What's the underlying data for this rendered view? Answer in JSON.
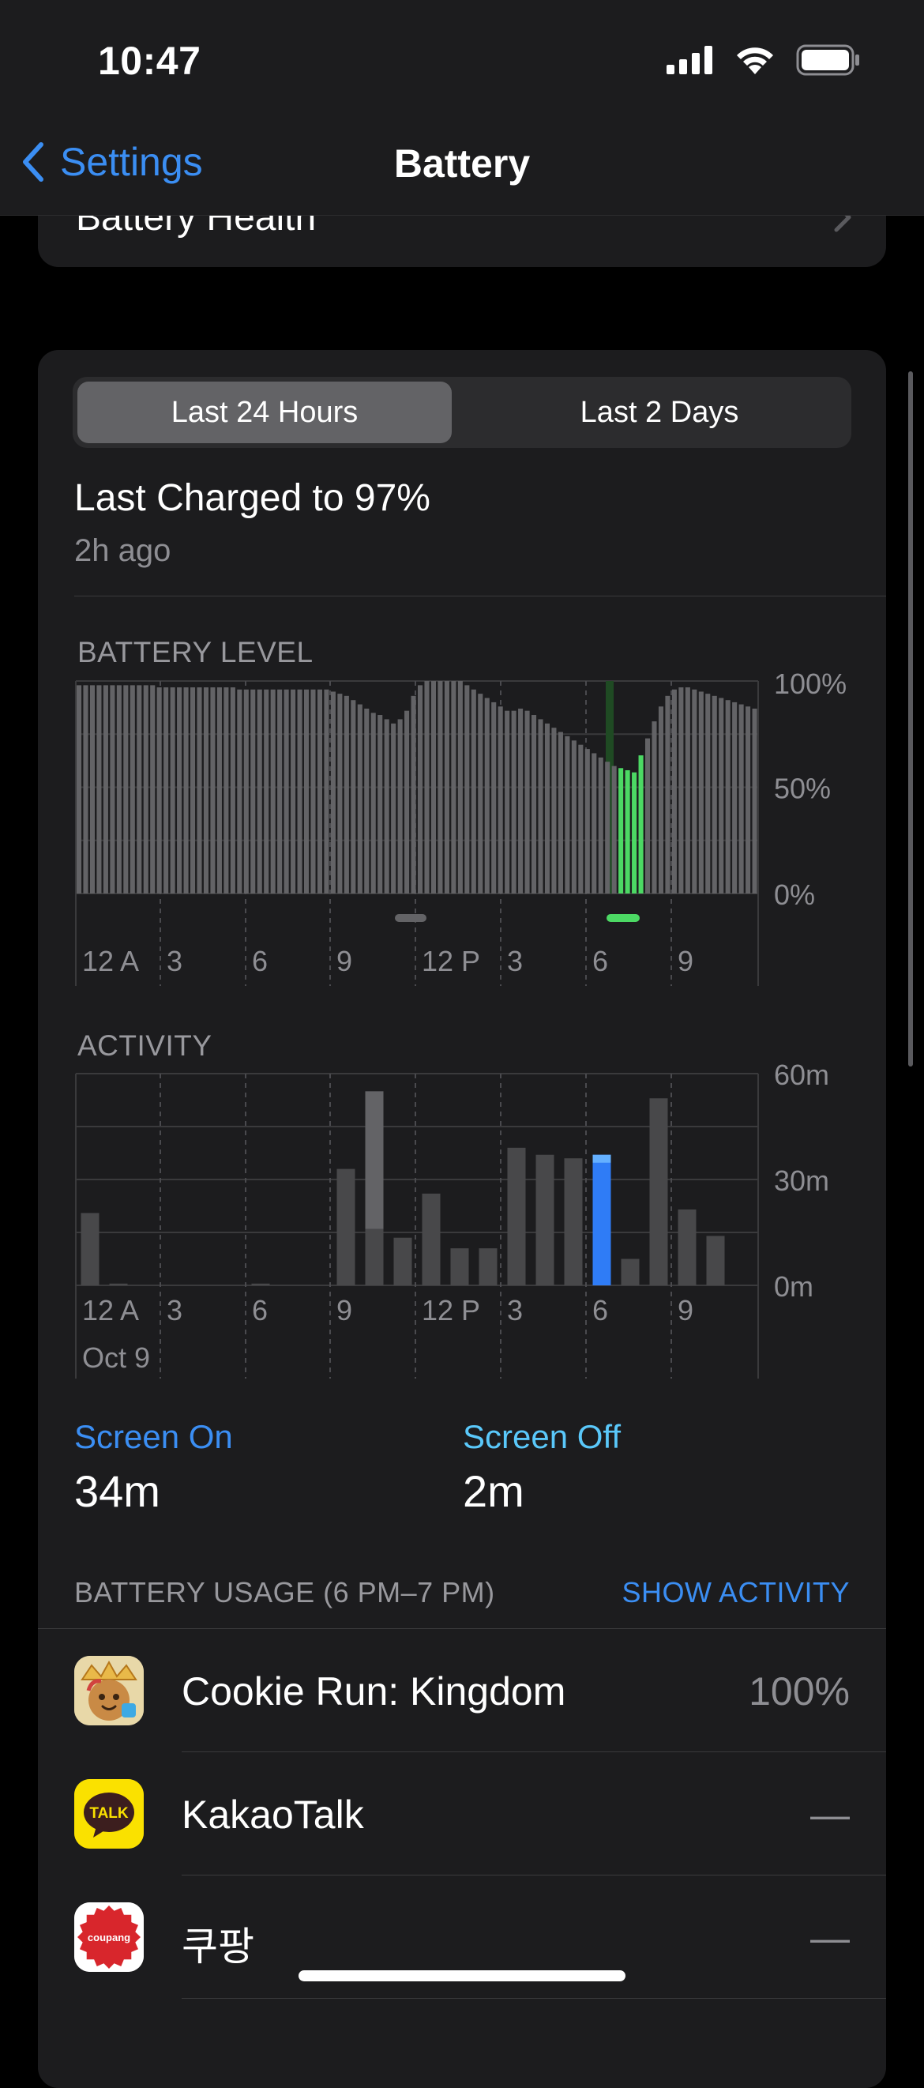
{
  "status": {
    "time": "10:47"
  },
  "nav": {
    "back_label": "Settings",
    "title": "Battery"
  },
  "health": {
    "label": "Battery Health"
  },
  "segment": {
    "options": [
      "Last 24 Hours",
      "Last 2 Days"
    ],
    "selected": "Last 24 Hours"
  },
  "last_charged": {
    "title": "Last Charged to 97%",
    "ago": "2h ago"
  },
  "battery_level": {
    "label": "BATTERY LEVEL",
    "y_ticks": [
      "100%",
      "50%",
      "0%"
    ],
    "x_ticks": [
      "12 A",
      "3",
      "6",
      "9",
      "12 P",
      "3",
      "6",
      "9"
    ]
  },
  "activity": {
    "label": "ACTIVITY",
    "y_ticks": [
      "60m",
      "30m",
      "0m"
    ],
    "x_ticks": [
      "12 A",
      "3",
      "6",
      "9",
      "12 P",
      "3",
      "6",
      "9"
    ],
    "date": "Oct 9"
  },
  "chart_data": [
    {
      "type": "bar",
      "title": "BATTERY LEVEL",
      "ylim": [
        0,
        100
      ],
      "x_unit": "hours since 12 AM",
      "values": [
        98,
        98,
        98,
        98,
        98,
        98,
        98,
        98,
        98,
        98,
        98,
        98,
        97,
        97,
        97,
        97,
        97,
        97,
        97,
        97,
        97,
        97,
        97,
        97,
        96,
        96,
        96,
        96,
        96,
        96,
        96,
        96,
        96,
        96,
        96,
        96,
        96,
        96,
        95,
        94,
        93,
        91,
        89,
        87,
        85,
        84,
        82,
        80,
        82,
        86,
        93,
        98,
        100,
        100,
        100,
        100,
        100,
        100,
        98,
        96,
        94,
        92,
        90,
        88,
        86,
        86,
        87,
        86,
        84,
        82,
        80,
        78,
        76,
        74,
        72,
        70,
        68,
        66,
        64,
        62,
        60,
        59,
        58,
        57,
        65,
        73,
        81,
        88,
        93,
        96,
        97,
        97,
        96,
        95,
        94,
        93,
        92,
        91,
        90,
        89,
        88,
        87
      ],
      "charging_indices": [
        81,
        82,
        83,
        84
      ],
      "charging_color": "#4cd964",
      "bar_color": "#636366",
      "grid": true
    },
    {
      "type": "bar",
      "title": "ACTIVITY",
      "ylim": [
        0,
        60
      ],
      "x_unit": "hours since 12 AM",
      "categories": [
        "12 A",
        "",
        "",
        "3",
        "",
        "",
        "6",
        "",
        "",
        "9",
        "",
        "",
        "12 P",
        "",
        "",
        "3",
        "",
        "",
        "6",
        "",
        "",
        "9",
        "",
        ""
      ],
      "series": [
        {
          "name": "Screen On",
          "values": [
            20.5,
            0.5,
            0,
            0,
            0,
            0,
            0.5,
            0,
            0,
            33,
            16,
            13.5,
            26,
            10.5,
            10.5,
            39,
            37,
            36,
            37,
            7.5,
            53,
            21.5,
            14,
            0
          ]
        },
        {
          "name": "Screen Off",
          "values": [
            0,
            0,
            0,
            0,
            0,
            0,
            0,
            0,
            0,
            0,
            39,
            0,
            0,
            0,
            0,
            0,
            0,
            0,
            0,
            0,
            0,
            0,
            0,
            0
          ]
        }
      ],
      "selected_hour": 18,
      "selected_color_on": "#2f7cf6",
      "selected_color_off": "#64b0ff",
      "grid": true
    }
  ],
  "screen_on": {
    "label": "Screen On",
    "value": "34m"
  },
  "screen_off": {
    "label": "Screen Off",
    "value": "2m"
  },
  "usage": {
    "header": "BATTERY USAGE (6 PM–7 PM)",
    "show_activity": "SHOW ACTIVITY",
    "apps": [
      {
        "name": "Cookie Run: Kingdom",
        "value": "100%"
      },
      {
        "name": "KakaoTalk",
        "value": "—"
      },
      {
        "name": "쿠팡",
        "value": "—"
      }
    ]
  },
  "icons": {
    "kakao_text": "TALK",
    "coupang_text": "coupang"
  },
  "colors": {
    "accent": "#3b8ef3",
    "screen_off_label": "#5ac8fa",
    "background": "#000000",
    "card": "#1c1c1e"
  }
}
